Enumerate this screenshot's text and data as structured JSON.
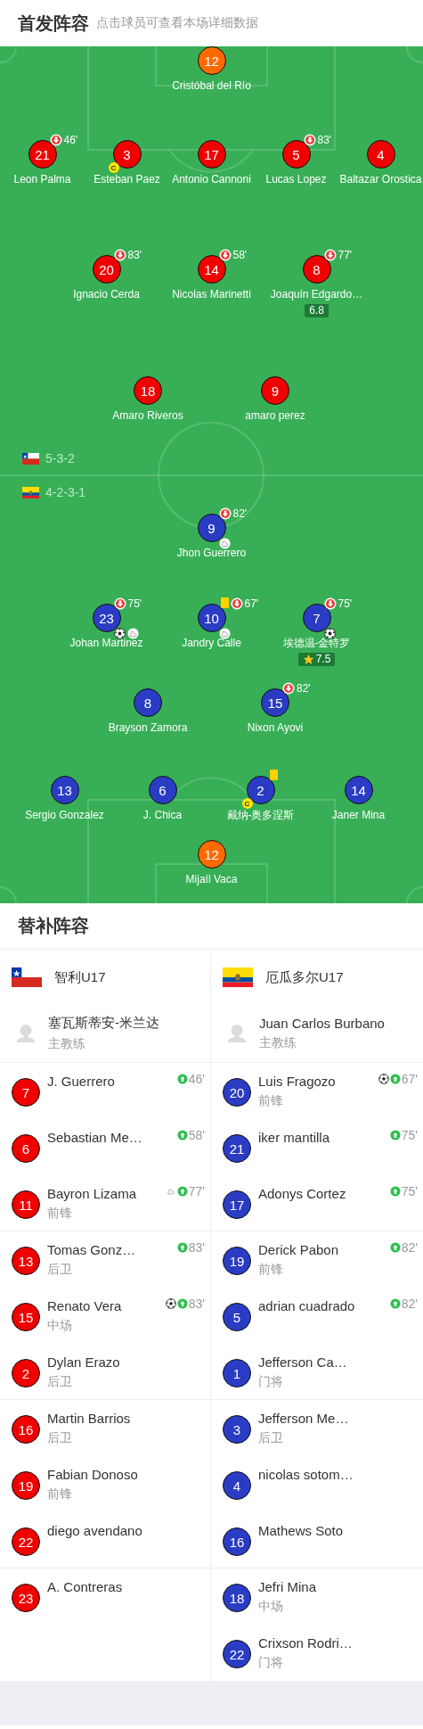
{
  "header": {
    "title": "首发阵容",
    "subtitle": "点击球员可查看本场详细数据"
  },
  "home": {
    "flag": {
      "kind": "chile"
    },
    "formation": "5-3-2",
    "lines": [
      [
        {
          "number": "12",
          "name": "Cristóbal del Río",
          "color": "#ff6a00"
        }
      ],
      [
        {
          "number": "21",
          "name": "Leon Palma",
          "color": "#f00000",
          "sub_out": "46'"
        },
        {
          "number": "3",
          "name": "Esteban Paez",
          "color": "#f00000",
          "captain": "C"
        },
        {
          "number": "17",
          "name": "Antonio Cannoni",
          "color": "#f00000"
        },
        {
          "number": "5",
          "name": "Lucas Lopez",
          "color": "#f00000",
          "sub_out": "83'"
        },
        {
          "number": "4",
          "name": "Baltazar Orostica",
          "color": "#f00000"
        }
      ],
      [
        {
          "number": "20",
          "name": "Ignacio Cerda",
          "color": "#f00000",
          "sub_out": "83'"
        },
        {
          "number": "14",
          "name": "Nicolas Marinetti",
          "color": "#f00000",
          "sub_out": "58'"
        },
        {
          "number": "8",
          "name": "Joaquín Edgardo…",
          "color": "#f00000",
          "sub_out": "77'",
          "rating": "6.8"
        }
      ],
      [
        {
          "number": "18",
          "name": "Amaro Riveros",
          "color": "#f00000"
        },
        {
          "number": "9",
          "name": "amaro perez",
          "color": "#f00000"
        }
      ]
    ]
  },
  "away": {
    "flag": {
      "kind": "ecuador"
    },
    "formation": "4-2-3-1",
    "lines": [
      [
        {
          "number": "9",
          "name": "Jhon Guerrero",
          "color": "#2b3cc4",
          "sub_out": "82'",
          "assist": true
        }
      ],
      [
        {
          "number": "23",
          "name": "Johan Martinez",
          "color": "#2b3cc4",
          "sub_out": "75'",
          "goal": true,
          "assist": true
        },
        {
          "number": "10",
          "name": "Jandry Calle",
          "color": "#2b3cc4",
          "yellow_card": true,
          "sub_out": "67'",
          "assist": true
        },
        {
          "number": "7",
          "name": "埃德温-金特罗",
          "color": "#2b3cc4",
          "sub_out": "75'",
          "goal": true,
          "rating": "7.5",
          "top_rated": true
        }
      ],
      [
        {
          "number": "8",
          "name": "Brayson Zamora",
          "color": "#2b3cc4"
        },
        {
          "number": "15",
          "name": "Nixon Ayovi",
          "color": "#2b3cc4",
          "sub_out": "82'"
        }
      ],
      [
        {
          "number": "13",
          "name": "Sergio Gonzalez",
          "color": "#2b3cc4"
        },
        {
          "number": "6",
          "name": "J. Chica",
          "color": "#2b3cc4"
        },
        {
          "number": "2",
          "name": "戴纳-奥多涅斯",
          "color": "#2b3cc4",
          "captain": "C",
          "yellow_card": true
        },
        {
          "number": "14",
          "name": "Janer Mina",
          "color": "#2b3cc4"
        }
      ],
      [
        {
          "number": "12",
          "name": "Mijaíl Vaca",
          "color": "#ff6a00"
        }
      ]
    ]
  },
  "subs": {
    "title": "替补阵容",
    "teams": [
      {
        "name": "智利U17",
        "flag": {
          "kind": "chile"
        },
        "color": "#f00000",
        "coach": {
          "name": "塞瓦斯蒂安-米兰达",
          "role": "主教练"
        },
        "players": [
          {
            "number": "7",
            "name": "J. Guerrero",
            "sub_in": "46'"
          },
          {
            "number": "6",
            "name": "Sebastian Me…",
            "sub_in": "58'"
          },
          {
            "number": "11",
            "name": "Bayron Lizama",
            "position": "前锋",
            "assist": true,
            "sub_in": "77'"
          },
          {
            "number": "13",
            "name": "Tomas Gonz…",
            "position": "后卫",
            "sub_in": "83'"
          },
          {
            "number": "15",
            "name": "Renato Vera",
            "position": "中场",
            "goal": true,
            "sub_in": "83'"
          },
          {
            "number": "2",
            "name": "Dylan Erazo",
            "position": "后卫"
          },
          {
            "number": "16",
            "name": "Martin Barrios",
            "position": "后卫"
          },
          {
            "number": "19",
            "name": "Fabian Donoso",
            "position": "前锋"
          },
          {
            "number": "22",
            "name": "diego avendano"
          },
          {
            "number": "23",
            "name": "A. Contreras"
          }
        ]
      },
      {
        "name": "厄瓜多尔U17",
        "flag": {
          "kind": "ecuador"
        },
        "color": "#2b3cc4",
        "coach": {
          "name": "Juan Carlos Burbano",
          "role": "主教练"
        },
        "players": [
          {
            "number": "20",
            "name": "Luis Fragozo",
            "position": "前锋",
            "goal": true,
            "sub_in": "67'"
          },
          {
            "number": "21",
            "name": "iker mantilla",
            "sub_in": "75'"
          },
          {
            "number": "17",
            "name": "Adonys Cortez",
            "sub_in": "75'"
          },
          {
            "number": "19",
            "name": "Derick Pabon",
            "position": "前锋",
            "sub_in": "82'"
          },
          {
            "number": "5",
            "name": "adrian cuadrado",
            "sub_in": "82'"
          },
          {
            "number": "1",
            "name": "Jefferson Ca…",
            "position": "门将"
          },
          {
            "number": "3",
            "name": "Jefferson Me…",
            "position": "后卫"
          },
          {
            "number": "4",
            "name": "nicolas sotom…"
          },
          {
            "number": "16",
            "name": "Mathews Soto"
          },
          {
            "number": "18",
            "name": "Jefri Mina",
            "position": "中场"
          },
          {
            "number": "22",
            "name": "Crixson Rodri…",
            "position": "门将"
          }
        ]
      }
    ]
  }
}
